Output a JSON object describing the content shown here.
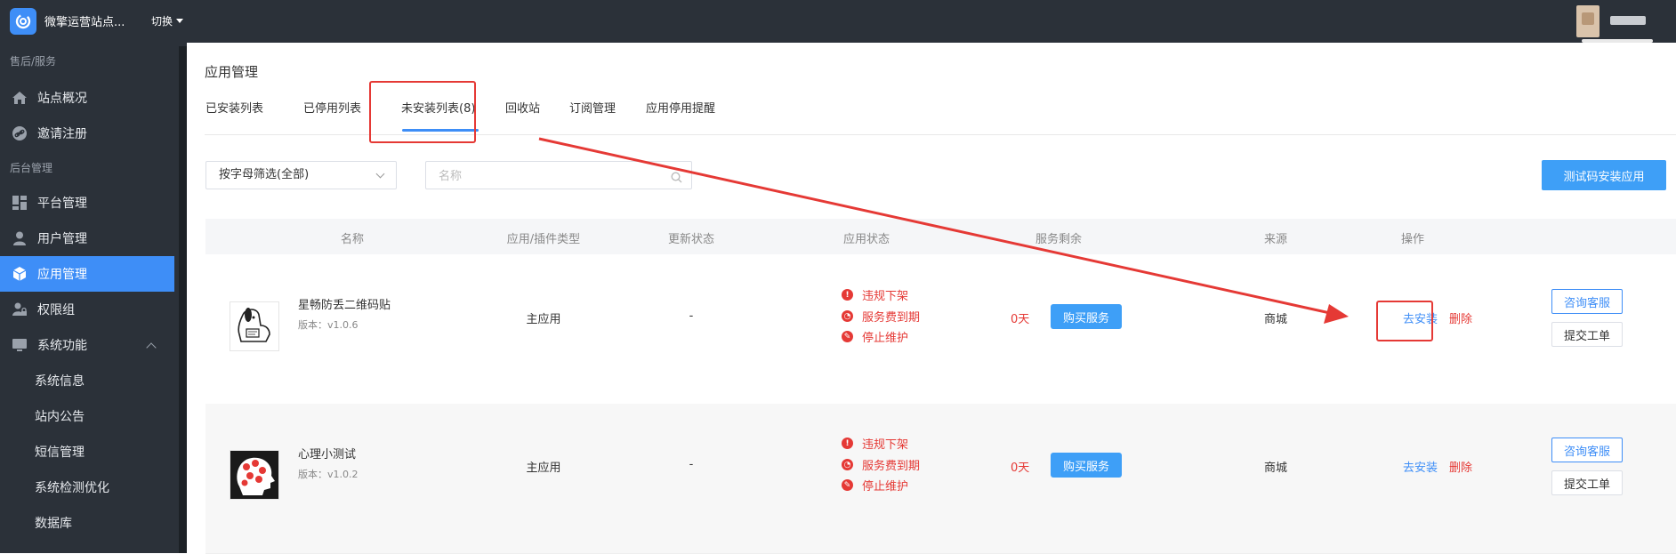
{
  "header": {
    "site_name": "微擎运营站点...",
    "switch_label": "切换"
  },
  "sidebar": {
    "section_after_sales": "售后/服务",
    "section_backend": "后台管理",
    "items": [
      {
        "label": "站点概况",
        "icon": "home-icon"
      },
      {
        "label": "邀请注册",
        "icon": "link-icon"
      },
      {
        "label": "平台管理",
        "icon": "grid-icon"
      },
      {
        "label": "用户管理",
        "icon": "user-icon"
      },
      {
        "label": "应用管理",
        "icon": "cube-icon",
        "active": true
      },
      {
        "label": "权限组",
        "icon": "user-lock-icon"
      },
      {
        "label": "系统功能",
        "icon": "monitor-icon"
      }
    ],
    "sub_items": [
      "系统信息",
      "站内公告",
      "短信管理",
      "系统检测优化",
      "数据库"
    ]
  },
  "main": {
    "title": "应用管理",
    "tabs": [
      "已安装列表",
      "已停用列表",
      "未安装列表(8)",
      "回收站",
      "订阅管理",
      "应用停用提醒"
    ],
    "active_tab": 2,
    "filter_select": "按字母筛选(全部)",
    "search_placeholder": "名称",
    "test_install_button": "测试码安装应用"
  },
  "table": {
    "headers": [
      "名称",
      "应用/插件类型",
      "更新状态",
      "应用状态",
      "服务剩余",
      "来源",
      "操作"
    ],
    "status_labels": [
      "违规下架",
      "服务费到期",
      "停止维护"
    ],
    "rows": [
      {
        "name": "星畅防丢二维码贴",
        "version": "版本：v1.0.6",
        "type": "主应用",
        "update": "-",
        "days": "0天",
        "buy": "购买服务",
        "source": "商城",
        "install": "去安装",
        "delete": "删除",
        "consult": "咨询客服",
        "ticket": "提交工单"
      },
      {
        "name": "心理小测试",
        "version": "版本：v1.0.2",
        "type": "主应用",
        "update": "-",
        "days": "0天",
        "buy": "购买服务",
        "source": "商城",
        "install": "去安装",
        "delete": "删除",
        "consult": "咨询客服",
        "ticket": "提交工单"
      }
    ]
  },
  "colors": {
    "accent": "#3e8ef7",
    "sidebar_bg": "#2b3139",
    "danger": "#e53935",
    "annotation": "#e53935"
  }
}
